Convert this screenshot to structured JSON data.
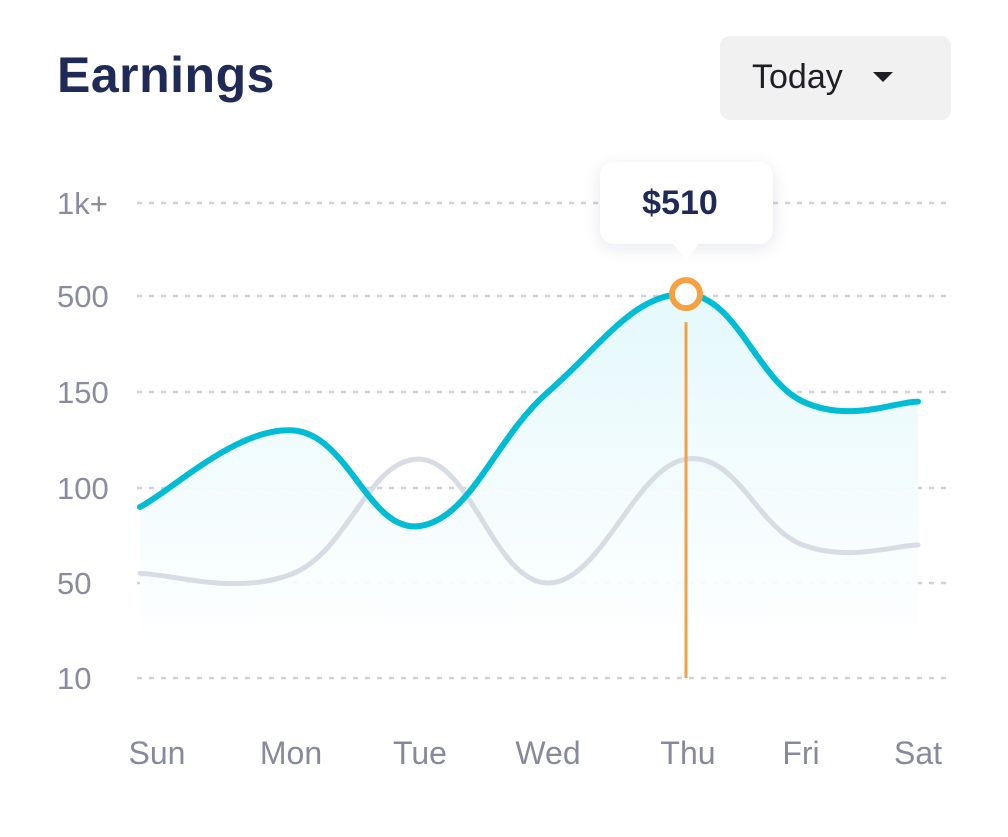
{
  "header": {
    "title": "Earnings",
    "period_select": {
      "label": "Today",
      "icon": "caret-down-icon"
    }
  },
  "chart_data": {
    "type": "line",
    "categories": [
      "Sun",
      "Mon",
      "Tue",
      "Wed",
      "Thu",
      "Fri",
      "Sat"
    ],
    "y_ticks": [
      "10",
      "50",
      "100",
      "150",
      "500",
      "1k+"
    ],
    "y_scale": "ordinal tick ladder (10, 50, 100, 150, 500, 1k+)",
    "grid": "dashed horizontal",
    "series": [
      {
        "values": [
          90,
          130,
          80,
          150,
          510,
          145,
          145
        ],
        "color": "#00bcd4",
        "area_fill": "#e6f9fb",
        "highlighted": true
      },
      {
        "values": [
          55,
          55,
          115,
          50,
          115,
          70,
          70
        ],
        "color": "#d8dce4"
      }
    ],
    "highlight": {
      "category": "Thu",
      "value": 510,
      "label": "$510",
      "marker_color": "#f5a142"
    }
  }
}
